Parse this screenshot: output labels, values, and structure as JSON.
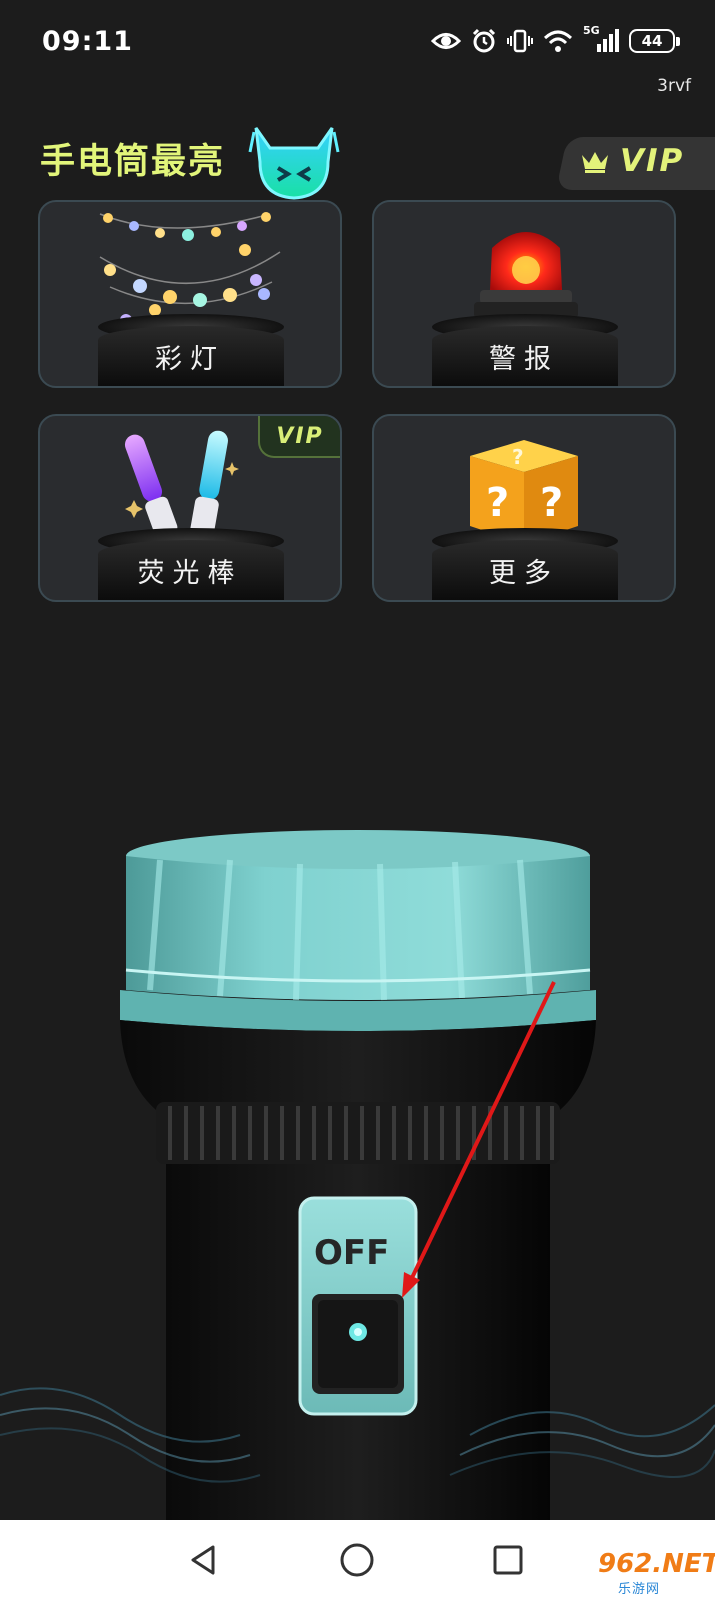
{
  "status_bar": {
    "time": "09:11",
    "network": "5G",
    "battery": "44",
    "icons": [
      "eye-icon",
      "alarm-icon",
      "vibrate-icon",
      "wifi-icon",
      "signal-icon",
      "battery-icon"
    ]
  },
  "build_tag": "3rvf",
  "header": {
    "title": "手电筒最亮",
    "vip_label": "VIP"
  },
  "modes": [
    {
      "label": "彩灯",
      "icon": "string-lights-icon",
      "vip": false
    },
    {
      "label": "警报",
      "icon": "siren-icon",
      "vip": false
    },
    {
      "label": "荧光棒",
      "icon": "glow-sticks-icon",
      "vip": true,
      "badge": "VIP"
    },
    {
      "label": "更多",
      "icon": "mystery-box-icon",
      "vip": false
    }
  ],
  "flashlight": {
    "switch_state": "OFF"
  },
  "nav": {
    "items": [
      "back-icon",
      "home-icon",
      "recents-icon"
    ]
  },
  "watermark": {
    "text": "962.NET",
    "sub": "乐游网"
  },
  "colors": {
    "accent": "#e2f57a",
    "background": "#1c1c1c",
    "flashlight_teal": "#7fd1cf"
  }
}
